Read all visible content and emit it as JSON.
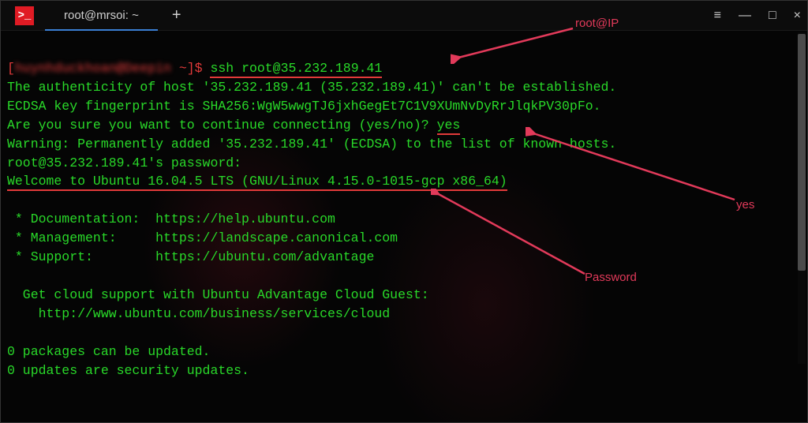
{
  "titlebar": {
    "tab_title": "root@mrsoi: ~",
    "new_tab_label": "+",
    "menu_icon": "≡",
    "minimize_icon": "—",
    "maximize_icon": "□",
    "close_icon": "×",
    "app_prompt_glyph": ">_"
  },
  "terminal": {
    "prompt_user_blurred": "huynhduckhoan@Deepin",
    "prompt_path": " ~]$ ",
    "command": "ssh root@35.232.189.41",
    "l2": "The authenticity of host '35.232.189.41 (35.232.189.41)' can't be established.",
    "l3": "ECDSA key fingerprint is SHA256:WgW5wwgTJ6jxhGegEt7C1V9XUmNvDyRrJlqkPV30pFo.",
    "l4a": "Are you sure you want to continue connecting (yes/no)? ",
    "l4b": "yes",
    "l5": "Warning: Permanently added '35.232.189.41' (ECDSA) to the list of known hosts.",
    "l6": "root@35.232.189.41's password:",
    "l7": "Welcome to Ubuntu 16.04.5 LTS (GNU/Linux 4.15.0-1015-gcp x86_64)",
    "blank": "",
    "l9": " * Documentation:  https://help.ubuntu.com",
    "l10": " * Management:     https://landscape.canonical.com",
    "l11": " * Support:        https://ubuntu.com/advantage",
    "l13": "  Get cloud support with Ubuntu Advantage Cloud Guest:",
    "l14": "    http://www.ubuntu.com/business/services/cloud",
    "l16": "0 packages can be updated.",
    "l17": "0 updates are security updates."
  },
  "annotations": {
    "a1": "root@IP",
    "a2": "yes",
    "a3": "Password"
  },
  "colors": {
    "accent_red": "#e23a3a",
    "term_green": "#29d929",
    "annotation_pink": "#e23a5a"
  }
}
